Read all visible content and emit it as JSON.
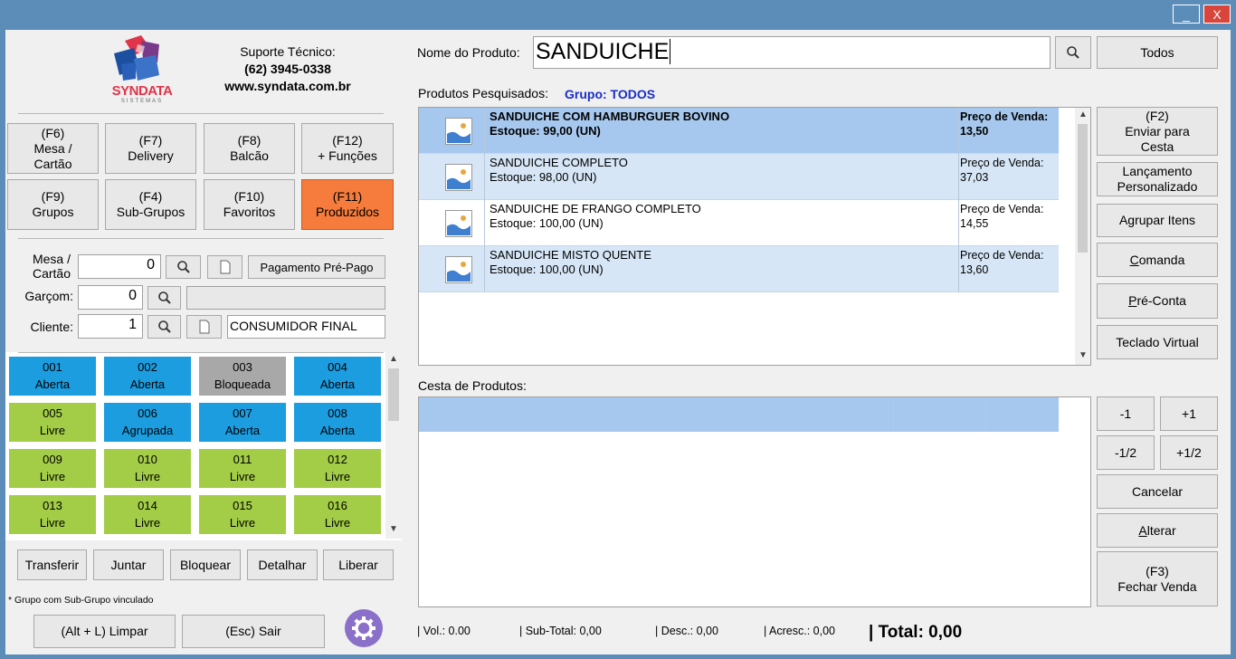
{
  "window": {
    "minimize_label": "_",
    "close_label": "X"
  },
  "left": {
    "logo": {
      "brand": "SYNDATA",
      "sub": "SISTEMAS",
      "colors": [
        "#1c4fa0",
        "#e0344b",
        "#7a3a8a"
      ]
    },
    "support": {
      "title": "Suporte Técnico:",
      "phone": "(62) 3945-0338",
      "site": "www.syndata.com.br"
    },
    "fkeys": [
      {
        "key": "(F6)",
        "label1": "Mesa /",
        "label2": "Cartão"
      },
      {
        "key": "(F7)",
        "label1": "Delivery",
        "label2": ""
      },
      {
        "key": "(F8)",
        "label1": "Balcão",
        "label2": ""
      },
      {
        "key": "(F12)",
        "label1": "+ Funções",
        "label2": ""
      },
      {
        "key": "(F9)",
        "label1": "Grupos",
        "label2": ""
      },
      {
        "key": "(F4)",
        "label1": "Sub-Grupos",
        "label2": ""
      },
      {
        "key": "(F10)",
        "label1": "Favoritos",
        "label2": ""
      },
      {
        "key": "(F11)",
        "label1": "Produzidos",
        "label2": ""
      }
    ],
    "active_color": "#f57c3c",
    "form": {
      "mesa_label1": "Mesa /",
      "mesa_label2": "Cartão",
      "mesa_value": "0",
      "prepago_button": "Pagamento Pré-Pago",
      "garcom_label": "Garçom:",
      "garcom_value": "0",
      "garcom_name": "",
      "cliente_label": "Cliente:",
      "cliente_value": "1",
      "cliente_name": "CONSUMIDOR FINAL"
    },
    "tiles": [
      {
        "num": "001",
        "status": "Aberta"
      },
      {
        "num": "002",
        "status": "Aberta"
      },
      {
        "num": "003",
        "status": "Bloqueada"
      },
      {
        "num": "004",
        "status": "Aberta"
      },
      {
        "num": "005",
        "status": "Livre"
      },
      {
        "num": "006",
        "status": "Agrupada"
      },
      {
        "num": "007",
        "status": "Aberta"
      },
      {
        "num": "008",
        "status": "Aberta"
      },
      {
        "num": "009",
        "status": "Livre"
      },
      {
        "num": "010",
        "status": "Livre"
      },
      {
        "num": "011",
        "status": "Livre"
      },
      {
        "num": "012",
        "status": "Livre"
      },
      {
        "num": "013",
        "status": "Livre"
      },
      {
        "num": "014",
        "status": "Livre"
      },
      {
        "num": "015",
        "status": "Livre"
      },
      {
        "num": "016",
        "status": "Livre"
      }
    ],
    "status_colors": {
      "Aberta": "#1c9de0",
      "Livre": "#a3cd47",
      "Bloqueada": "#a8a8a8",
      "Agrupada": "#1c9de0"
    },
    "actions": [
      "Transferir",
      "Juntar",
      "Bloquear",
      "Detalhar",
      "Liberar"
    ],
    "note": "* Grupo com Sub-Grupo vinculado",
    "limpar_button": "(Alt + L) Limpar",
    "sair_button": "(Esc) Sair"
  },
  "right": {
    "search_label": "Nome do Produto:",
    "search_value": "SANDUICHE",
    "todos_button": "Todos",
    "products_label": "Produtos Pesquisados:",
    "group_label": "Grupo: TODOS",
    "products": [
      {
        "name": "SANDUICHE COM HAMBURGUER BOVINO",
        "stock": "Estoque: 99,00 (UN)",
        "price_label": "Preço de Venda:",
        "price": "13,50"
      },
      {
        "name": "SANDUICHE COMPLETO",
        "stock": "Estoque: 98,00 (UN)",
        "price_label": "Preço de Venda:",
        "price": "37,03"
      },
      {
        "name": "SANDUICHE DE FRANGO COMPLETO",
        "stock": "Estoque: 100,00 (UN)",
        "price_label": "Preço de Venda:",
        "price": "14,55"
      },
      {
        "name": "SANDUICHE MISTO QUENTE",
        "stock": "Estoque: 100,00 (UN)",
        "price_label": "Preço de Venda:",
        "price": "13,60"
      }
    ],
    "side_buttons": {
      "enviar": [
        "(F2)",
        "Enviar para",
        "Cesta"
      ],
      "lancamento": [
        "Lançamento",
        "Personalizado"
      ],
      "agrupar": "Agrupar Itens",
      "comanda_u": "C",
      "comanda_rest": "omanda",
      "preconta_u": "P",
      "preconta_rest": "ré-Conta",
      "teclado": "Teclado Virtual"
    },
    "cesta_label": "Cesta de Produtos:",
    "qty_buttons": [
      "-1",
      "+1",
      "-1/2",
      "+1/2"
    ],
    "cancelar": "Cancelar",
    "alterar_u": "A",
    "alterar_rest": "lterar",
    "fechar": [
      "(F3)",
      "Fechar Venda"
    ],
    "totals": {
      "vol": "| Vol.: 0.00",
      "subtotal": "| Sub-Total: 0,00",
      "desc": "| Desc.: 0,00",
      "acresc": "| Acresc.: 0,00",
      "total": "| Total: 0,00"
    }
  }
}
